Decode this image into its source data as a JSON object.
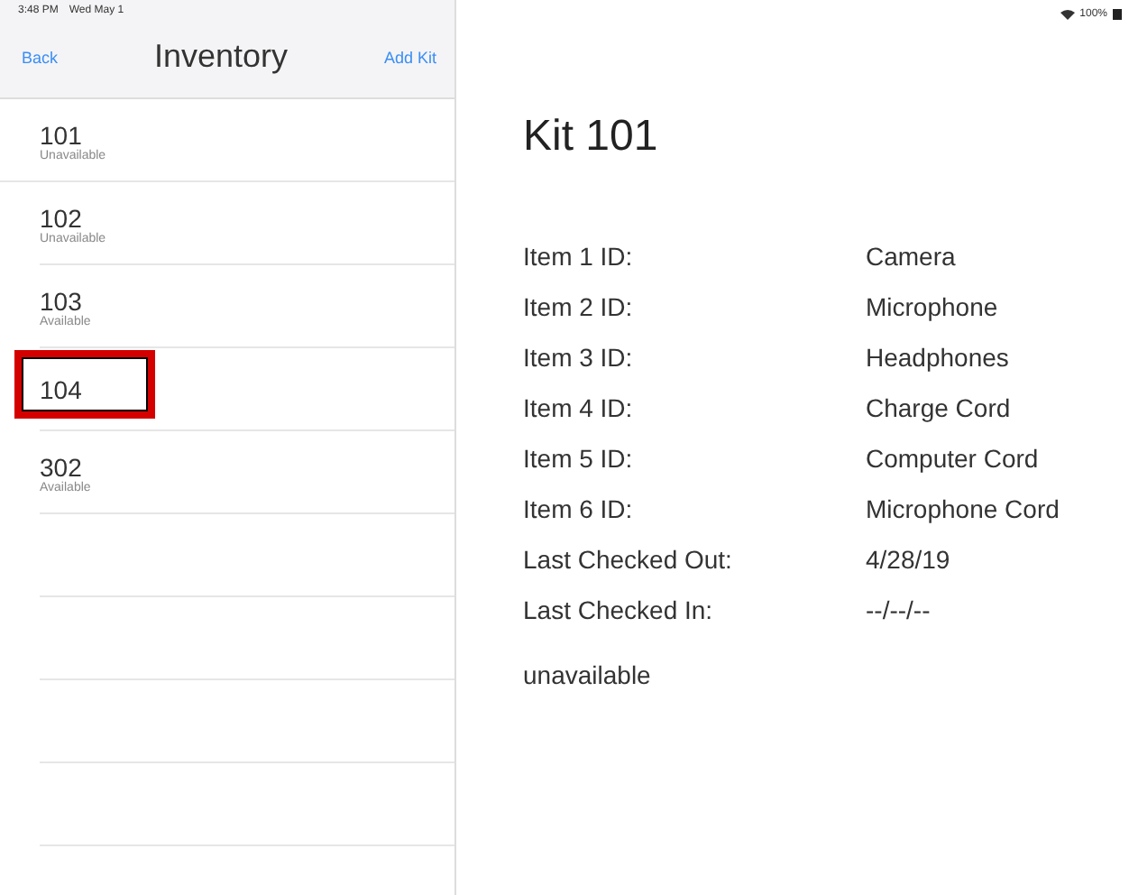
{
  "status_bar": {
    "time": "3:48 PM",
    "date": "Wed May 1",
    "battery": "100%"
  },
  "nav": {
    "back": "Back",
    "title": "Inventory",
    "action": "Add Kit"
  },
  "kits": [
    {
      "number": "101",
      "status": "Unavailable",
      "highlighted": false
    },
    {
      "number": "102",
      "status": "Unavailable",
      "highlighted": false
    },
    {
      "number": "103",
      "status": "Available",
      "highlighted": false
    },
    {
      "number": "104",
      "highlighted": true
    },
    {
      "number": "302",
      "status": "Available",
      "highlighted": false
    }
  ],
  "detail": {
    "title": "Kit 101",
    "items": [
      {
        "label": "Item 1 ID:",
        "value": "Camera"
      },
      {
        "label": "Item 2 ID:",
        "value": "Microphone"
      },
      {
        "label": "Item 3 ID:",
        "value": "Headphones"
      },
      {
        "label": "Item 4 ID:",
        "value": "Charge Cord"
      },
      {
        "label": "Item 5 ID:",
        "value": "Computer Cord"
      },
      {
        "label": "Item 6 ID:",
        "value": "Microphone Cord"
      }
    ],
    "dates": [
      {
        "label": "Last Checked Out:",
        "value": "4/28/19"
      },
      {
        "label": "Last Checked In:",
        "value": "--/--/--"
      }
    ],
    "availability": "unavailable"
  }
}
